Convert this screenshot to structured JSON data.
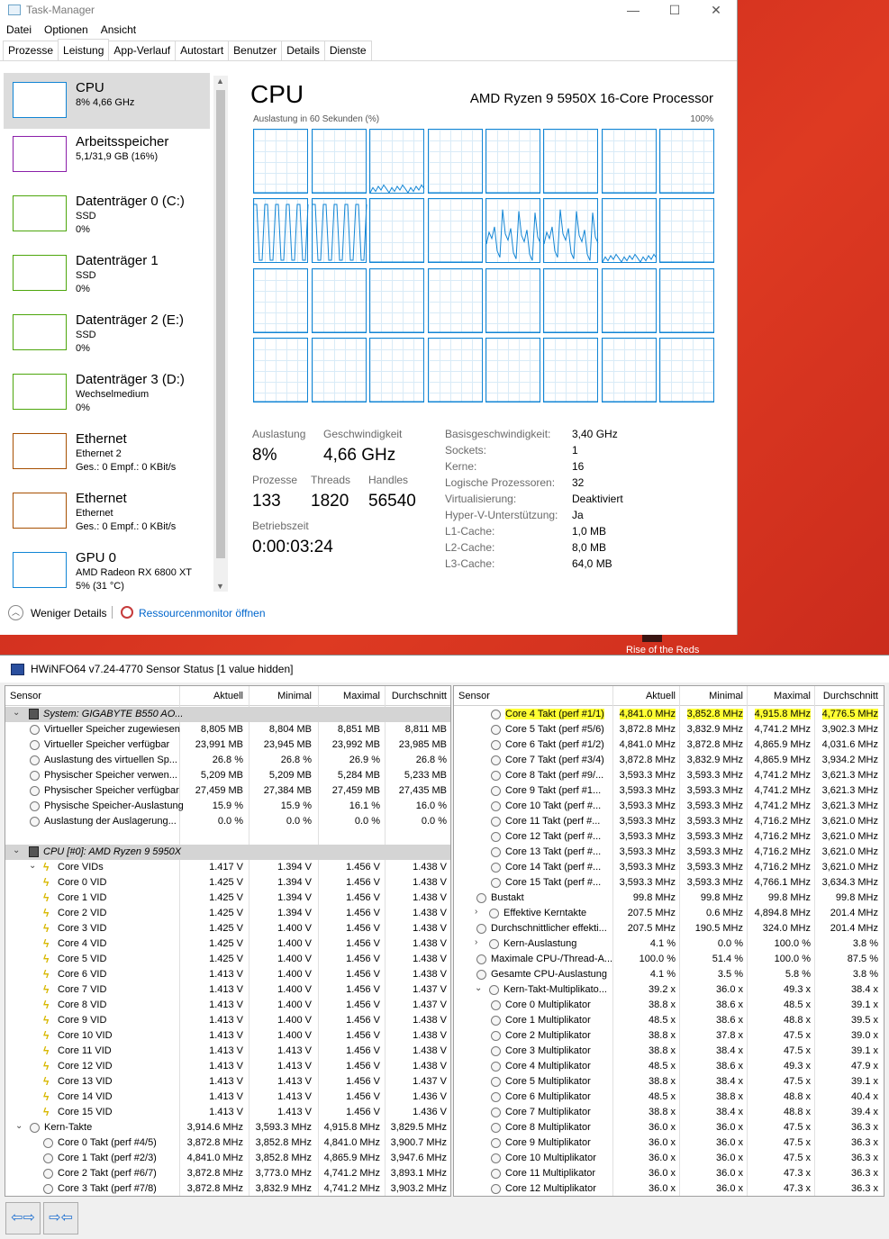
{
  "background": {
    "text": "Rise of the Reds"
  },
  "taskmanager": {
    "title": "Task-Manager",
    "window_buttons": [
      "—",
      "☐",
      "✕"
    ],
    "menu": [
      "Datei",
      "Optionen",
      "Ansicht"
    ],
    "tabs": [
      "Prozesse",
      "Leistung",
      "App-Verlauf",
      "Autostart",
      "Benutzer",
      "Details",
      "Dienste"
    ],
    "active_tab": "Leistung",
    "sidebar": [
      {
        "title": "CPU",
        "sub1": "8% 4,66 GHz",
        "sub2": "",
        "color": "#1185d5"
      },
      {
        "title": "Arbeitsspeicher",
        "sub1": "5,1/31,9 GB (16%)",
        "sub2": "",
        "color": "#8b1fa9"
      },
      {
        "title": "Datenträger 0 (C:)",
        "sub1": "SSD",
        "sub2": "0%",
        "color": "#4da60c"
      },
      {
        "title": "Datenträger 1",
        "sub1": "SSD",
        "sub2": "0%",
        "color": "#4da60c"
      },
      {
        "title": "Datenträger 2 (E:)",
        "sub1": "SSD",
        "sub2": "0%",
        "color": "#4da60c"
      },
      {
        "title": "Datenträger 3 (D:)",
        "sub1": "Wechselmedium",
        "sub2": "0%",
        "color": "#4da60c"
      },
      {
        "title": "Ethernet",
        "sub1": "Ethernet 2",
        "sub2": "Ges.: 0 Empf.: 0 KBit/s",
        "color": "#a74f01"
      },
      {
        "title": "Ethernet",
        "sub1": "Ethernet",
        "sub2": "Ges.: 0 Empf.: 0 KBit/s",
        "color": "#a74f01"
      },
      {
        "title": "GPU 0",
        "sub1": "AMD Radeon RX 6800 XT",
        "sub2": "5% (31 °C)",
        "color": "#1185d5"
      }
    ],
    "main": {
      "title": "CPU",
      "processor": "AMD Ryzen 9 5950X 16-Core Processor",
      "graph_label": "Auslastung in 60 Sekunden (%)",
      "graph_max": "100%",
      "stats": {
        "util_label": "Auslastung",
        "util": "8%",
        "speed_label": "Geschwindigkeit",
        "speed": "4,66 GHz",
        "proc_label": "Prozesse",
        "proc": "133",
        "threads_label": "Threads",
        "threads": "1820",
        "handles_label": "Handles",
        "handles": "56540",
        "uptime_label": "Betriebszeit",
        "uptime": "0:00:03:24"
      },
      "details": [
        {
          "k": "Basisgeschwindigkeit:",
          "v": "3,40 GHz"
        },
        {
          "k": "Sockets:",
          "v": "1"
        },
        {
          "k": "Kerne:",
          "v": "16"
        },
        {
          "k": "Logische Prozessoren:",
          "v": "32"
        },
        {
          "k": "Virtualisierung:",
          "v": "Deaktiviert"
        },
        {
          "k": "Hyper-V-Unterstützung:",
          "v": "Ja"
        },
        {
          "k": "L1-Cache:",
          "v": "1,0 MB"
        },
        {
          "k": "L2-Cache:",
          "v": "8,0 MB"
        },
        {
          "k": "L3-Cache:",
          "v": "64,0 MB"
        }
      ]
    },
    "footer": {
      "fewer": "Weniger Details",
      "resmon": "Ressourcenmonitor öffnen"
    }
  },
  "hwinfo": {
    "title": "HWiNFO64 v7.24-4770 Sensor Status [1 value hidden]",
    "headers": [
      "Sensor",
      "Aktuell",
      "Minimal",
      "Maximal",
      "Durchschnitt"
    ],
    "left_rows": [
      {
        "t": "grp",
        "n": "System: GIGABYTE B550 AO...",
        "v": [
          "",
          "",
          "",
          ""
        ]
      },
      {
        "t": "c",
        "n": "Virtueller Speicher zugewiesen",
        "v": [
          "8,805 MB",
          "8,804 MB",
          "8,851 MB",
          "8,811 MB"
        ]
      },
      {
        "t": "c",
        "n": "Virtueller Speicher verfügbar",
        "v": [
          "23,991 MB",
          "23,945 MB",
          "23,992 MB",
          "23,985 MB"
        ]
      },
      {
        "t": "c",
        "n": "Auslastung des virtuellen Sp...",
        "v": [
          "26.8 %",
          "26.8 %",
          "26.9 %",
          "26.8 %"
        ]
      },
      {
        "t": "c",
        "n": "Physischer Speicher verwen...",
        "v": [
          "5,209 MB",
          "5,209 MB",
          "5,284 MB",
          "5,233 MB"
        ]
      },
      {
        "t": "c",
        "n": "Physischer Speicher verfügbar",
        "v": [
          "27,459 MB",
          "27,384 MB",
          "27,459 MB",
          "27,435 MB"
        ]
      },
      {
        "t": "c",
        "n": "Physische Speicher-Auslastung",
        "v": [
          "15.9 %",
          "15.9 %",
          "16.1 %",
          "16.0 %"
        ]
      },
      {
        "t": "c",
        "n": "Auslastung der Auslagerung...",
        "v": [
          "0.0 %",
          "0.0 %",
          "0.0 %",
          "0.0 %"
        ]
      },
      {
        "t": "blank",
        "n": "",
        "v": [
          "",
          "",
          "",
          ""
        ]
      },
      {
        "t": "grp",
        "n": "CPU [#0]: AMD Ryzen 9 5950X",
        "v": [
          "",
          "",
          "",
          ""
        ]
      },
      {
        "t": "bx",
        "n": "Core VIDs",
        "v": [
          "1.417 V",
          "1.394 V",
          "1.456 V",
          "1.438 V"
        ]
      },
      {
        "t": "b",
        "n": "Core 0 VID",
        "v": [
          "1.425 V",
          "1.394 V",
          "1.456 V",
          "1.438 V"
        ]
      },
      {
        "t": "b",
        "n": "Core 1 VID",
        "v": [
          "1.425 V",
          "1.394 V",
          "1.456 V",
          "1.438 V"
        ]
      },
      {
        "t": "b",
        "n": "Core 2 VID",
        "v": [
          "1.425 V",
          "1.394 V",
          "1.456 V",
          "1.438 V"
        ]
      },
      {
        "t": "b",
        "n": "Core 3 VID",
        "v": [
          "1.425 V",
          "1.400 V",
          "1.456 V",
          "1.438 V"
        ]
      },
      {
        "t": "b",
        "n": "Core 4 VID",
        "v": [
          "1.425 V",
          "1.400 V",
          "1.456 V",
          "1.438 V"
        ]
      },
      {
        "t": "b",
        "n": "Core 5 VID",
        "v": [
          "1.425 V",
          "1.400 V",
          "1.456 V",
          "1.438 V"
        ]
      },
      {
        "t": "b",
        "n": "Core 6 VID",
        "v": [
          "1.413 V",
          "1.400 V",
          "1.456 V",
          "1.438 V"
        ]
      },
      {
        "t": "b",
        "n": "Core 7 VID",
        "v": [
          "1.413 V",
          "1.400 V",
          "1.456 V",
          "1.437 V"
        ]
      },
      {
        "t": "b",
        "n": "Core 8 VID",
        "v": [
          "1.413 V",
          "1.400 V",
          "1.456 V",
          "1.437 V"
        ]
      },
      {
        "t": "b",
        "n": "Core 9 VID",
        "v": [
          "1.413 V",
          "1.400 V",
          "1.456 V",
          "1.438 V"
        ]
      },
      {
        "t": "b",
        "n": "Core 10 VID",
        "v": [
          "1.413 V",
          "1.400 V",
          "1.456 V",
          "1.438 V"
        ]
      },
      {
        "t": "b",
        "n": "Core 11 VID",
        "v": [
          "1.413 V",
          "1.413 V",
          "1.456 V",
          "1.438 V"
        ]
      },
      {
        "t": "b",
        "n": "Core 12 VID",
        "v": [
          "1.413 V",
          "1.413 V",
          "1.456 V",
          "1.438 V"
        ]
      },
      {
        "t": "b",
        "n": "Core 13 VID",
        "v": [
          "1.413 V",
          "1.413 V",
          "1.456 V",
          "1.437 V"
        ]
      },
      {
        "t": "b",
        "n": "Core 14 VID",
        "v": [
          "1.413 V",
          "1.413 V",
          "1.456 V",
          "1.436 V"
        ]
      },
      {
        "t": "b",
        "n": "Core 15 VID",
        "v": [
          "1.413 V",
          "1.413 V",
          "1.456 V",
          "1.436 V"
        ]
      },
      {
        "t": "cx",
        "n": "Kern-Takte",
        "v": [
          "3,914.6 MHz",
          "3,593.3 MHz",
          "4,915.8 MHz",
          "3,829.5 MHz"
        ]
      },
      {
        "t": "c2",
        "n": "Core 0 Takt (perf #4/5)",
        "v": [
          "3,872.8 MHz",
          "3,852.8 MHz",
          "4,841.0 MHz",
          "3,900.7 MHz"
        ]
      },
      {
        "t": "c2",
        "n": "Core 1 Takt (perf #2/3)",
        "v": [
          "4,841.0 MHz",
          "3,852.8 MHz",
          "4,865.9 MHz",
          "3,947.6 MHz"
        ]
      },
      {
        "t": "c2",
        "n": "Core 2 Takt (perf #6/7)",
        "v": [
          "3,872.8 MHz",
          "3,773.0 MHz",
          "4,741.2 MHz",
          "3,893.1 MHz"
        ]
      },
      {
        "t": "c2",
        "n": "Core 3 Takt (perf #7/8)",
        "v": [
          "3,872.8 MHz",
          "3,832.9 MHz",
          "4,741.2 MHz",
          "3,903.2 MHz"
        ]
      }
    ],
    "right_rows": [
      {
        "t": "c2",
        "hl": true,
        "n": "Core 4 Takt (perf #1/1)",
        "v": [
          "4,841.0 MHz",
          "3,852.8 MHz",
          "4,915.8 MHz",
          "4,776.5 MHz"
        ]
      },
      {
        "t": "c2",
        "n": "Core 5 Takt (perf #5/6)",
        "v": [
          "3,872.8 MHz",
          "3,832.9 MHz",
          "4,741.2 MHz",
          "3,902.3 MHz"
        ]
      },
      {
        "t": "c2",
        "n": "Core 6 Takt (perf #1/2)",
        "v": [
          "4,841.0 MHz",
          "3,872.8 MHz",
          "4,865.9 MHz",
          "4,031.6 MHz"
        ]
      },
      {
        "t": "c2",
        "n": "Core 7 Takt (perf #3/4)",
        "v": [
          "3,872.8 MHz",
          "3,832.9 MHz",
          "4,865.9 MHz",
          "3,934.2 MHz"
        ]
      },
      {
        "t": "c2",
        "n": "Core 8 Takt (perf #9/...",
        "v": [
          "3,593.3 MHz",
          "3,593.3 MHz",
          "4,741.2 MHz",
          "3,621.3 MHz"
        ]
      },
      {
        "t": "c2",
        "n": "Core 9 Takt (perf #1...",
        "v": [
          "3,593.3 MHz",
          "3,593.3 MHz",
          "4,741.2 MHz",
          "3,621.3 MHz"
        ]
      },
      {
        "t": "c2",
        "n": "Core 10 Takt (perf #...",
        "v": [
          "3,593.3 MHz",
          "3,593.3 MHz",
          "4,741.2 MHz",
          "3,621.3 MHz"
        ]
      },
      {
        "t": "c2",
        "n": "Core 11 Takt (perf #...",
        "v": [
          "3,593.3 MHz",
          "3,593.3 MHz",
          "4,716.2 MHz",
          "3,621.0 MHz"
        ]
      },
      {
        "t": "c2",
        "n": "Core 12 Takt (perf #...",
        "v": [
          "3,593.3 MHz",
          "3,593.3 MHz",
          "4,716.2 MHz",
          "3,621.0 MHz"
        ]
      },
      {
        "t": "c2",
        "n": "Core 13 Takt (perf #...",
        "v": [
          "3,593.3 MHz",
          "3,593.3 MHz",
          "4,716.2 MHz",
          "3,621.0 MHz"
        ]
      },
      {
        "t": "c2",
        "n": "Core 14 Takt (perf #...",
        "v": [
          "3,593.3 MHz",
          "3,593.3 MHz",
          "4,716.2 MHz",
          "3,621.0 MHz"
        ]
      },
      {
        "t": "c2",
        "n": "Core 15 Takt (perf #...",
        "v": [
          "3,593.3 MHz",
          "3,593.3 MHz",
          "4,766.1 MHz",
          "3,634.3 MHz"
        ]
      },
      {
        "t": "c",
        "n": "Bustakt",
        "v": [
          "99.8 MHz",
          "99.8 MHz",
          "99.8 MHz",
          "99.8 MHz"
        ]
      },
      {
        "t": "ce",
        "n": "Effektive Kerntakte",
        "v": [
          "207.5 MHz",
          "0.6 MHz",
          "4,894.8 MHz",
          "201.4 MHz"
        ]
      },
      {
        "t": "c",
        "n": "Durchschnittlicher effekti...",
        "v": [
          "207.5 MHz",
          "190.5 MHz",
          "324.0 MHz",
          "201.4 MHz"
        ]
      },
      {
        "t": "ce",
        "n": "Kern-Auslastung",
        "v": [
          "4.1 %",
          "0.0 %",
          "100.0 %",
          "3.8 %"
        ]
      },
      {
        "t": "c",
        "n": "Maximale CPU-/Thread-A...",
        "v": [
          "100.0 %",
          "51.4 %",
          "100.0 %",
          "87.5 %"
        ]
      },
      {
        "t": "c",
        "n": "Gesamte CPU-Auslastung",
        "v": [
          "4.1 %",
          "3.5 %",
          "5.8 %",
          "3.8 %"
        ]
      },
      {
        "t": "cx",
        "n": "Kern-Takt-Multiplikato...",
        "v": [
          "39.2 x",
          "36.0 x",
          "49.3 x",
          "38.4 x"
        ]
      },
      {
        "t": "c2",
        "n": "Core 0 Multiplikator",
        "v": [
          "38.8 x",
          "38.6 x",
          "48.5 x",
          "39.1 x"
        ]
      },
      {
        "t": "c2",
        "n": "Core 1 Multiplikator",
        "v": [
          "48.5 x",
          "38.6 x",
          "48.8 x",
          "39.5 x"
        ]
      },
      {
        "t": "c2",
        "n": "Core 2 Multiplikator",
        "v": [
          "38.8 x",
          "37.8 x",
          "47.5 x",
          "39.0 x"
        ]
      },
      {
        "t": "c2",
        "n": "Core 3 Multiplikator",
        "v": [
          "38.8 x",
          "38.4 x",
          "47.5 x",
          "39.1 x"
        ]
      },
      {
        "t": "c2",
        "n": "Core 4 Multiplikator",
        "v": [
          "48.5 x",
          "38.6 x",
          "49.3 x",
          "47.9 x"
        ]
      },
      {
        "t": "c2",
        "n": "Core 5 Multiplikator",
        "v": [
          "38.8 x",
          "38.4 x",
          "47.5 x",
          "39.1 x"
        ]
      },
      {
        "t": "c2",
        "n": "Core 6 Multiplikator",
        "v": [
          "48.5 x",
          "38.8 x",
          "48.8 x",
          "40.4 x"
        ]
      },
      {
        "t": "c2",
        "n": "Core 7 Multiplikator",
        "v": [
          "38.8 x",
          "38.4 x",
          "48.8 x",
          "39.4 x"
        ]
      },
      {
        "t": "c2",
        "n": "Core 8 Multiplikator",
        "v": [
          "36.0 x",
          "36.0 x",
          "47.5 x",
          "36.3 x"
        ]
      },
      {
        "t": "c2",
        "n": "Core 9 Multiplikator",
        "v": [
          "36.0 x",
          "36.0 x",
          "47.5 x",
          "36.3 x"
        ]
      },
      {
        "t": "c2",
        "n": "Core 10 Multiplikator",
        "v": [
          "36.0 x",
          "36.0 x",
          "47.5 x",
          "36.3 x"
        ]
      },
      {
        "t": "c2",
        "n": "Core 11 Multiplikator",
        "v": [
          "36.0 x",
          "36.0 x",
          "47.3 x",
          "36.3 x"
        ]
      },
      {
        "t": "c2",
        "n": "Core 12 Multiplikator",
        "v": [
          "36.0 x",
          "36.0 x",
          "47.3 x",
          "36.3 x"
        ]
      }
    ],
    "nav_buttons": [
      "⇦⇨",
      "⇨⇦"
    ]
  },
  "colors": {
    "accent": "#1185d5",
    "highlight": "#ffff33",
    "link": "#0066cc"
  }
}
